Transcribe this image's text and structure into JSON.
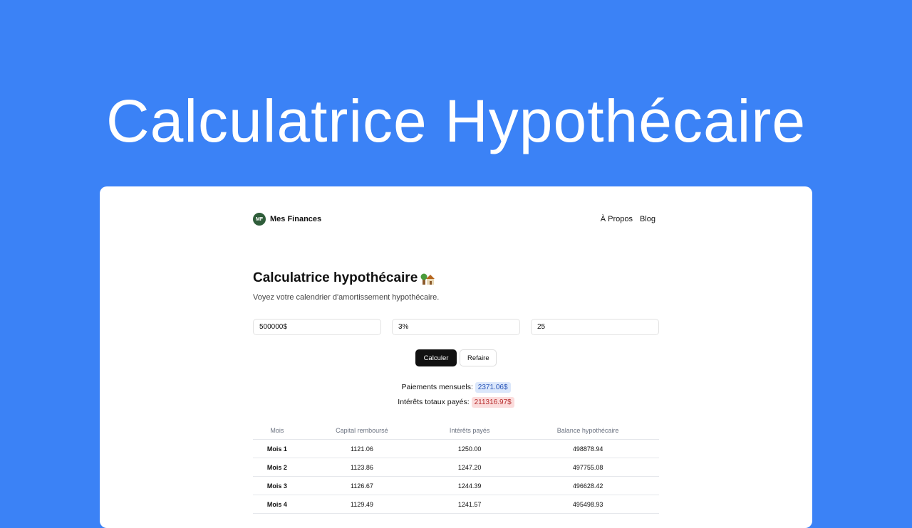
{
  "hero": {
    "title": "Calculatrice Hypothécaire"
  },
  "nav": {
    "logo_initials": "MF",
    "brand": "Mes Finances",
    "links": [
      "À Propos",
      "Blog"
    ]
  },
  "page": {
    "title": "Calculatrice hypothécaire",
    "title_icon": "house-emoji-icon",
    "subtitle": "Voyez votre calendrier d'amortissement hypothécaire."
  },
  "form": {
    "amount": "500000$",
    "rate": "3%",
    "years": "25",
    "calculate_label": "Calculer",
    "reset_label": "Refaire"
  },
  "results": {
    "monthly_label": "Paiements mensuels:",
    "monthly_value": "2371.06$",
    "interest_label": "Intérêts totaux payés:",
    "interest_value": "211316.97$"
  },
  "table": {
    "headers": [
      "Mois",
      "Capital remboursé",
      "Intérêts payés",
      "Balance hypothécaire"
    ],
    "rows": [
      [
        "Mois 1",
        "1121.06",
        "1250.00",
        "498878.94"
      ],
      [
        "Mois 2",
        "1123.86",
        "1247.20",
        "497755.08"
      ],
      [
        "Mois 3",
        "1126.67",
        "1244.39",
        "496628.42"
      ],
      [
        "Mois 4",
        "1129.49",
        "1241.57",
        "495498.93"
      ]
    ]
  },
  "colors": {
    "background": "#3b82f6",
    "card": "#ffffff",
    "primary_button": "#111111",
    "monthly_pill": "#dbe7fb",
    "interest_pill": "#fbdcdc"
  }
}
